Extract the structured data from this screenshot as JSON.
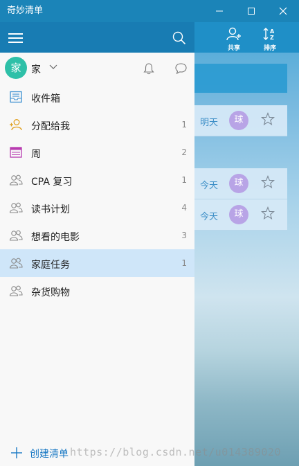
{
  "window": {
    "title": "奇妙清单"
  },
  "toolbar": {
    "share_label": "共享",
    "sort_label": "排序"
  },
  "account": {
    "avatar_char": "家",
    "name": "家"
  },
  "lists": [
    {
      "label": "收件箱",
      "count": "",
      "icon": "inbox-icon"
    },
    {
      "label": "分配给我",
      "count": "1",
      "icon": "assigned-user-icon"
    },
    {
      "label": "周",
      "count": "2",
      "icon": "calendar-week-icon"
    },
    {
      "label": "CPA 复习",
      "count": "1",
      "icon": "shared-list-icon"
    },
    {
      "label": "读书计划",
      "count": "4",
      "icon": "shared-list-icon"
    },
    {
      "label": "想看的电影",
      "count": "3",
      "icon": "shared-list-icon"
    },
    {
      "label": "家庭任务",
      "count": "1",
      "icon": "shared-list-icon",
      "selected": true
    },
    {
      "label": "杂货购物",
      "count": "",
      "icon": "shared-list-icon"
    }
  ],
  "create_list_label": "创建清单",
  "tasks": [
    {
      "due": "明天",
      "assignee": "球"
    },
    {
      "due": "今天",
      "assignee": "球"
    },
    {
      "due": "今天",
      "assignee": "球"
    }
  ],
  "watermark": "https://blog.csdn.net/u014389020",
  "colors": {
    "accent": "#187cb3",
    "selected_row": "#cfe6f9",
    "avatar": "#2ec0a8",
    "assignee": "#b8a4e6"
  }
}
